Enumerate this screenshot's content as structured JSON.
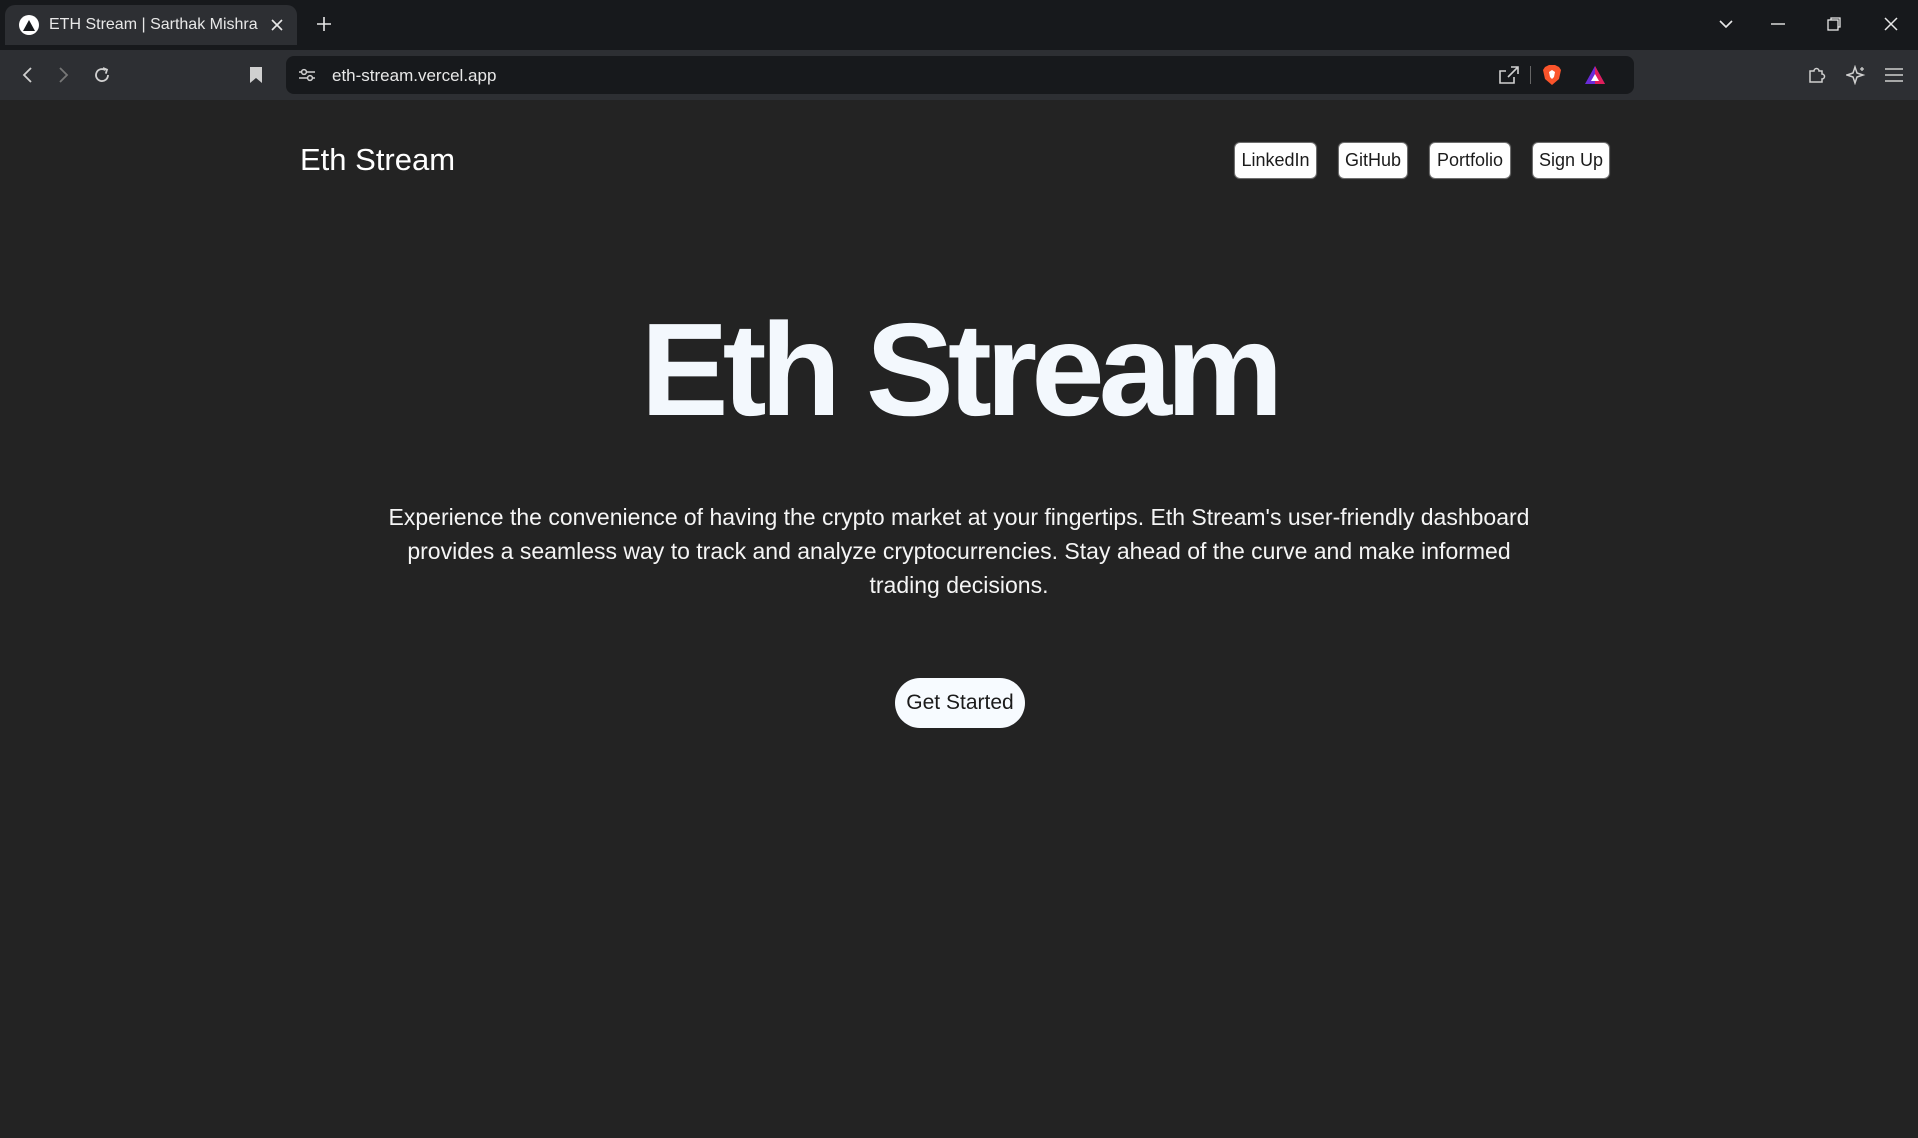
{
  "browser": {
    "tab_title": "ETH Stream | Sarthak Mishra",
    "url": "eth-stream.vercel.app"
  },
  "nav": {
    "brand": "Eth Stream",
    "links": [
      "LinkedIn",
      "GitHub",
      "Portfolio",
      "Sign Up"
    ]
  },
  "hero": {
    "title": "Eth Stream",
    "line1": "Experience the convenience of having the crypto market at your fingertips. Eth Stream's user-friendly dashboard",
    "line2": "provides a seamless way to track and analyze cryptocurrencies. Stay ahead of the curve and make informed",
    "line3": "trading decisions.",
    "cta": "Get Started"
  },
  "colors": {
    "page_bg": "#232323",
    "title": "#f3f8fd",
    "button_bg": "#ffffff",
    "chrome_dark": "#17191c",
    "chrome_mid": "#2d2f33"
  },
  "icons": [
    "favicon-icon",
    "close-icon",
    "plus-icon",
    "chevron-down-icon",
    "minimize-icon",
    "restore-icon",
    "close-window-icon",
    "back-icon",
    "forward-icon",
    "reload-icon",
    "bookmark-icon",
    "site-settings-icon",
    "share-icon",
    "brave-shields-icon",
    "brave-rewards-icon",
    "extensions-icon",
    "leo-icon",
    "menu-icon"
  ]
}
